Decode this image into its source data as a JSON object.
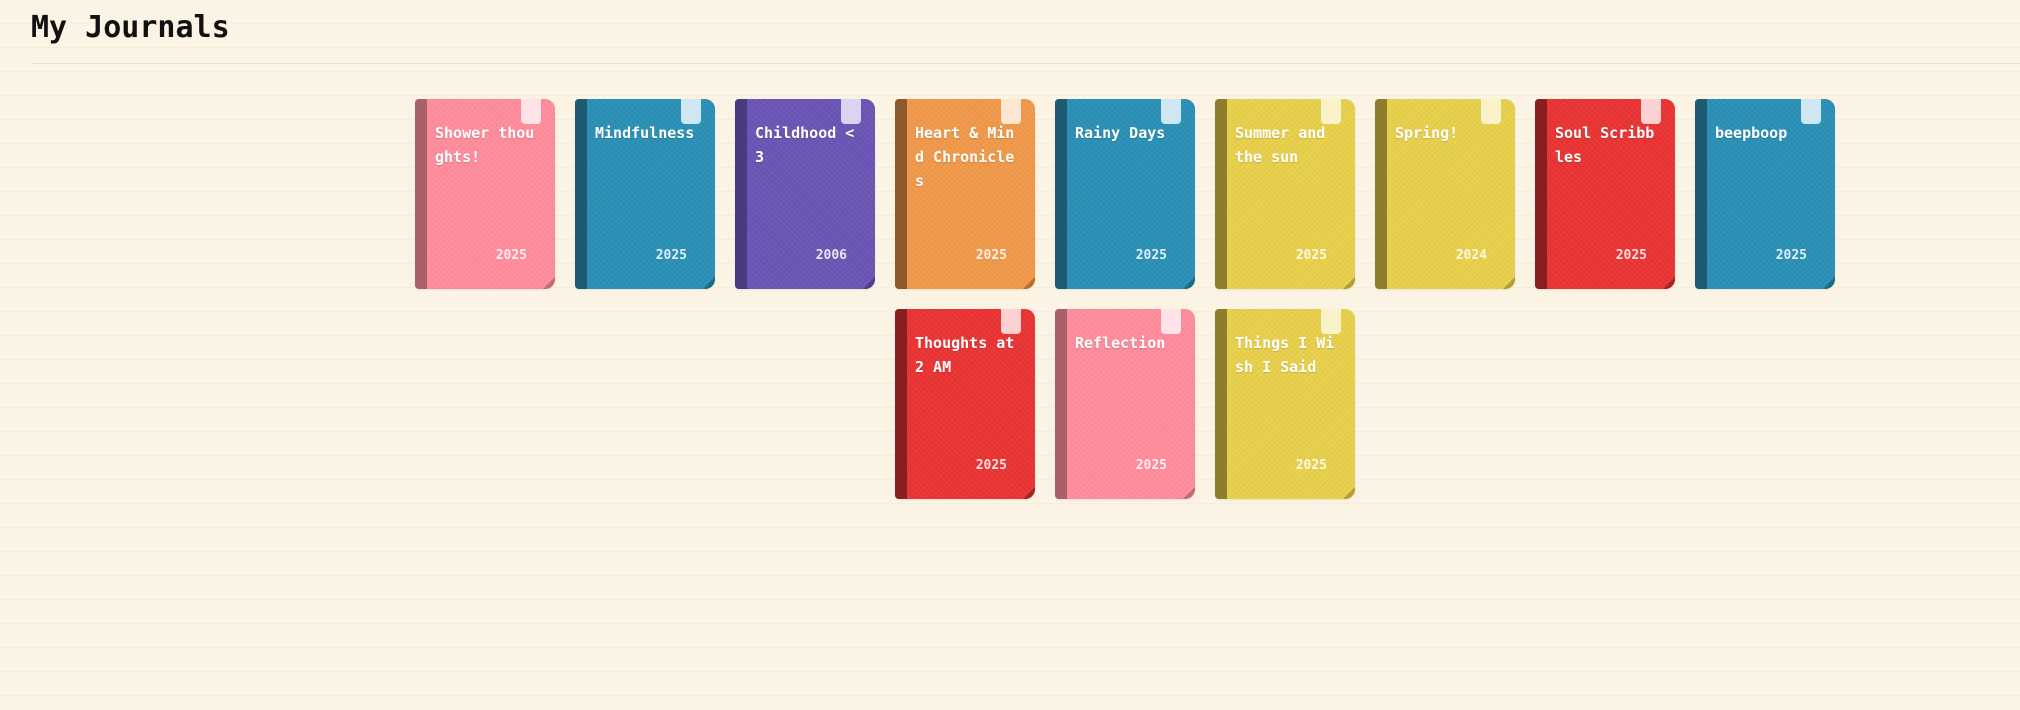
{
  "page": {
    "title": "My Journals"
  },
  "colors": {
    "background": "#fbf4e4",
    "pink": "#ff8c9c",
    "blue": "#2b90b6",
    "purple": "#6b55b4",
    "orange": "#f0994a",
    "yellow": "#e8d04c",
    "red": "#ea3434"
  },
  "journals": [
    {
      "title": "Shower thoughts!",
      "year": "2025",
      "color": "pink"
    },
    {
      "title": "Mindfulness",
      "year": "2025",
      "color": "blue"
    },
    {
      "title": "Childhood <3",
      "year": "2006",
      "color": "purple"
    },
    {
      "title": "Heart & Mind Chronicles",
      "year": "2025",
      "color": "orange"
    },
    {
      "title": "Rainy Days",
      "year": "2025",
      "color": "blue"
    },
    {
      "title": "Summer and the sun",
      "year": "2025",
      "color": "yellow"
    },
    {
      "title": "Spring!",
      "year": "2024",
      "color": "yellow"
    },
    {
      "title": "Soul Scribbles",
      "year": "2025",
      "color": "red"
    },
    {
      "title": "beepboop",
      "year": "2025",
      "color": "blue"
    },
    {
      "title": "Thoughts at 2 AM",
      "year": "2025",
      "color": "red"
    },
    {
      "title": "Reflection",
      "year": "2025",
      "color": "pink"
    },
    {
      "title": "Things I Wish I Said",
      "year": "2025",
      "color": "yellow"
    }
  ]
}
